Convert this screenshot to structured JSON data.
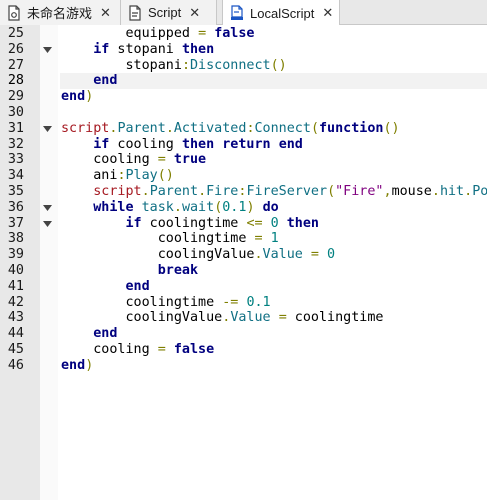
{
  "tabs": [
    {
      "label": "未命名游戏",
      "icon": "place-file-icon",
      "active": false,
      "close": "✕"
    },
    {
      "label": "Script",
      "icon": "script-icon",
      "active": false,
      "close": "✕"
    },
    {
      "label": "LocalScript",
      "icon": "local-script-icon",
      "active": true,
      "close": "✕"
    }
  ],
  "editor": {
    "current_line": 28,
    "lines": [
      {
        "n": "25",
        "fold": "",
        "tokens": [
          [
            "txt",
            "        equipped "
          ],
          [
            "op",
            "="
          ],
          [
            "txt",
            " "
          ],
          [
            "kw",
            "false"
          ]
        ]
      },
      {
        "n": "26",
        "fold": "v",
        "tokens": [
          [
            "txt",
            "    "
          ],
          [
            "kw",
            "if"
          ],
          [
            "txt",
            " stopani "
          ],
          [
            "kw",
            "then"
          ]
        ]
      },
      {
        "n": "27",
        "fold": "",
        "tokens": [
          [
            "txt",
            "        stopani"
          ],
          [
            "op",
            ":"
          ],
          [
            "meth",
            "Disconnect"
          ],
          [
            "op",
            "()"
          ]
        ]
      },
      {
        "n": "28",
        "fold": "",
        "tokens": [
          [
            "txt",
            "    "
          ],
          [
            "kw",
            "end"
          ]
        ]
      },
      {
        "n": "29",
        "fold": "",
        "tokens": [
          [
            "kw",
            "end"
          ],
          [
            "op",
            ")"
          ]
        ]
      },
      {
        "n": "30",
        "fold": "",
        "tokens": []
      },
      {
        "n": "31",
        "fold": "v",
        "tokens": [
          [
            "id",
            "script"
          ],
          [
            "op",
            "."
          ],
          [
            "meth",
            "Parent"
          ],
          [
            "op",
            "."
          ],
          [
            "meth",
            "Activated"
          ],
          [
            "op",
            ":"
          ],
          [
            "meth",
            "Connect"
          ],
          [
            "op",
            "("
          ],
          [
            "kw",
            "function"
          ],
          [
            "op",
            "()"
          ]
        ]
      },
      {
        "n": "32",
        "fold": "",
        "tokens": [
          [
            "txt",
            "    "
          ],
          [
            "kw",
            "if"
          ],
          [
            "txt",
            " cooling "
          ],
          [
            "kw",
            "then"
          ],
          [
            "txt",
            " "
          ],
          [
            "kw",
            "return"
          ],
          [
            "txt",
            " "
          ],
          [
            "kw",
            "end"
          ]
        ]
      },
      {
        "n": "33",
        "fold": "",
        "tokens": [
          [
            "txt",
            "    cooling "
          ],
          [
            "op",
            "="
          ],
          [
            "txt",
            " "
          ],
          [
            "kw",
            "true"
          ]
        ]
      },
      {
        "n": "34",
        "fold": "",
        "tokens": [
          [
            "txt",
            "    ani"
          ],
          [
            "op",
            ":"
          ],
          [
            "meth",
            "Play"
          ],
          [
            "op",
            "()"
          ]
        ]
      },
      {
        "n": "35",
        "fold": "",
        "tokens": [
          [
            "txt",
            "    "
          ],
          [
            "id",
            "script"
          ],
          [
            "op",
            "."
          ],
          [
            "meth",
            "Parent"
          ],
          [
            "op",
            "."
          ],
          [
            "meth",
            "Fire"
          ],
          [
            "op",
            ":"
          ],
          [
            "meth",
            "FireServer"
          ],
          [
            "op",
            "("
          ],
          [
            "str",
            "\"Fire\""
          ],
          [
            "op",
            ","
          ],
          [
            "txt",
            "mouse"
          ],
          [
            "op",
            "."
          ],
          [
            "meth",
            "hit"
          ],
          [
            "op",
            "."
          ],
          [
            "meth",
            "Position"
          ],
          [
            "op",
            ")"
          ]
        ]
      },
      {
        "n": "36",
        "fold": "v",
        "tokens": [
          [
            "txt",
            "    "
          ],
          [
            "kw",
            "while"
          ],
          [
            "txt",
            " "
          ],
          [
            "meth",
            "task"
          ],
          [
            "op",
            "."
          ],
          [
            "meth",
            "wait"
          ],
          [
            "op",
            "("
          ],
          [
            "num",
            "0.1"
          ],
          [
            "op",
            ")"
          ],
          [
            "txt",
            " "
          ],
          [
            "kw",
            "do"
          ]
        ]
      },
      {
        "n": "37",
        "fold": "v",
        "tokens": [
          [
            "txt",
            "        "
          ],
          [
            "kw",
            "if"
          ],
          [
            "txt",
            " coolingtime "
          ],
          [
            "op",
            "<="
          ],
          [
            "txt",
            " "
          ],
          [
            "num",
            "0"
          ],
          [
            "txt",
            " "
          ],
          [
            "kw",
            "then"
          ]
        ]
      },
      {
        "n": "38",
        "fold": "",
        "tokens": [
          [
            "txt",
            "            coolingtime "
          ],
          [
            "op",
            "="
          ],
          [
            "txt",
            " "
          ],
          [
            "num",
            "1"
          ]
        ]
      },
      {
        "n": "39",
        "fold": "",
        "tokens": [
          [
            "txt",
            "            coolingValue"
          ],
          [
            "op",
            "."
          ],
          [
            "meth",
            "Value"
          ],
          [
            "txt",
            " "
          ],
          [
            "op",
            "="
          ],
          [
            "txt",
            " "
          ],
          [
            "num",
            "0"
          ]
        ]
      },
      {
        "n": "40",
        "fold": "",
        "tokens": [
          [
            "txt",
            "            "
          ],
          [
            "kw",
            "break"
          ]
        ]
      },
      {
        "n": "41",
        "fold": "",
        "tokens": [
          [
            "txt",
            "        "
          ],
          [
            "kw",
            "end"
          ]
        ]
      },
      {
        "n": "42",
        "fold": "",
        "tokens": [
          [
            "txt",
            "        coolingtime "
          ],
          [
            "op",
            "-="
          ],
          [
            "txt",
            " "
          ],
          [
            "num",
            "0.1"
          ]
        ]
      },
      {
        "n": "43",
        "fold": "",
        "tokens": [
          [
            "txt",
            "        coolingValue"
          ],
          [
            "op",
            "."
          ],
          [
            "meth",
            "Value"
          ],
          [
            "txt",
            " "
          ],
          [
            "op",
            "="
          ],
          [
            "txt",
            " coolingtime"
          ]
        ]
      },
      {
        "n": "44",
        "fold": "",
        "tokens": [
          [
            "txt",
            "    "
          ],
          [
            "kw",
            "end"
          ]
        ]
      },
      {
        "n": "45",
        "fold": "",
        "tokens": [
          [
            "txt",
            "    cooling "
          ],
          [
            "op",
            "="
          ],
          [
            "txt",
            " "
          ],
          [
            "kw",
            "false"
          ]
        ]
      },
      {
        "n": "46",
        "fold": "",
        "tokens": [
          [
            "kw",
            "end"
          ],
          [
            "op",
            ")"
          ]
        ]
      }
    ]
  }
}
